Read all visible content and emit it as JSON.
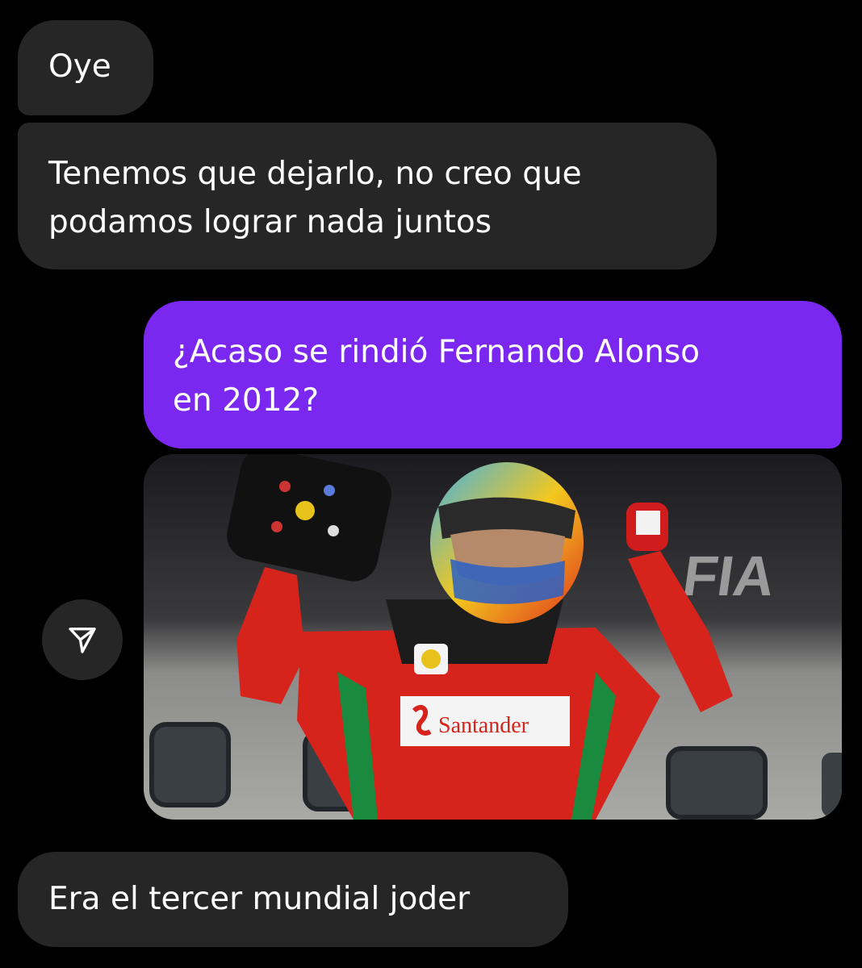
{
  "chat": {
    "received_1": "Oye",
    "received_2_line1": "Tenemos que dejarlo, no creo que",
    "received_2_line2": "podamos lograr nada juntos",
    "sent_line1": "¿Acaso se rindió Fernando Alonso",
    "sent_line2": "en 2012?",
    "received_3": "Era el tercer mundial joder"
  },
  "photo": {
    "suit_brand": "Santander",
    "wall_text": "FIA"
  },
  "icons": {
    "share": "send-icon"
  },
  "colors": {
    "background": "#000000",
    "received_bubble": "#262626",
    "sent_bubble": "#7a28f0"
  }
}
